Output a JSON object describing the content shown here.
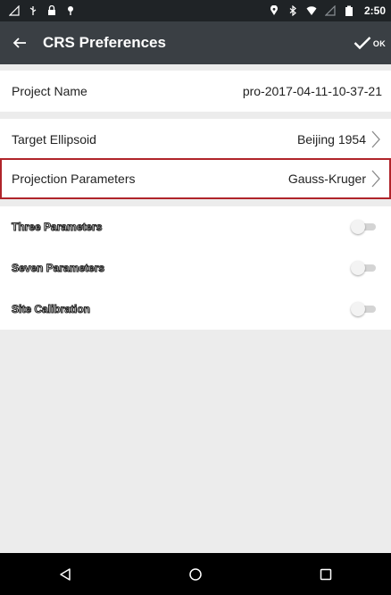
{
  "status_bar": {
    "time": "2:50",
    "icons_left": [
      "signal-icon",
      "usb-icon",
      "lock-icon",
      "location-pin-icon"
    ],
    "icons_right": [
      "location-icon",
      "bluetooth-icon",
      "wifi-icon",
      "no-sim-icon",
      "battery-icon"
    ]
  },
  "app_bar": {
    "title": "CRS Preferences",
    "ok_label": "OK"
  },
  "rows": {
    "project_name": {
      "label": "Project Name",
      "value": "pro-2017-04-11-10-37-21"
    },
    "target_ellipsoid": {
      "label": "Target Ellipsoid",
      "value": "Beijing 1954"
    },
    "projection_parameters": {
      "label": "Projection Parameters",
      "value": "Gauss-Kruger",
      "highlighted": true,
      "highlight_color": "#b0242a"
    },
    "three_parameters": {
      "label": "Three Parameters",
      "enabled": false
    },
    "seven_parameters": {
      "label": "Seven Parameters",
      "enabled": false
    },
    "site_calibration": {
      "label": "Site Calibration",
      "enabled": false
    }
  },
  "nav_bar": {
    "buttons": [
      "back-triangle-icon",
      "home-circle-icon",
      "recents-square-icon"
    ]
  },
  "colors": {
    "status_bar": "#1f2326",
    "app_bar": "#3a3f44",
    "background": "#ececec",
    "highlight": "#b0242a",
    "nav_bar": "#000000"
  }
}
